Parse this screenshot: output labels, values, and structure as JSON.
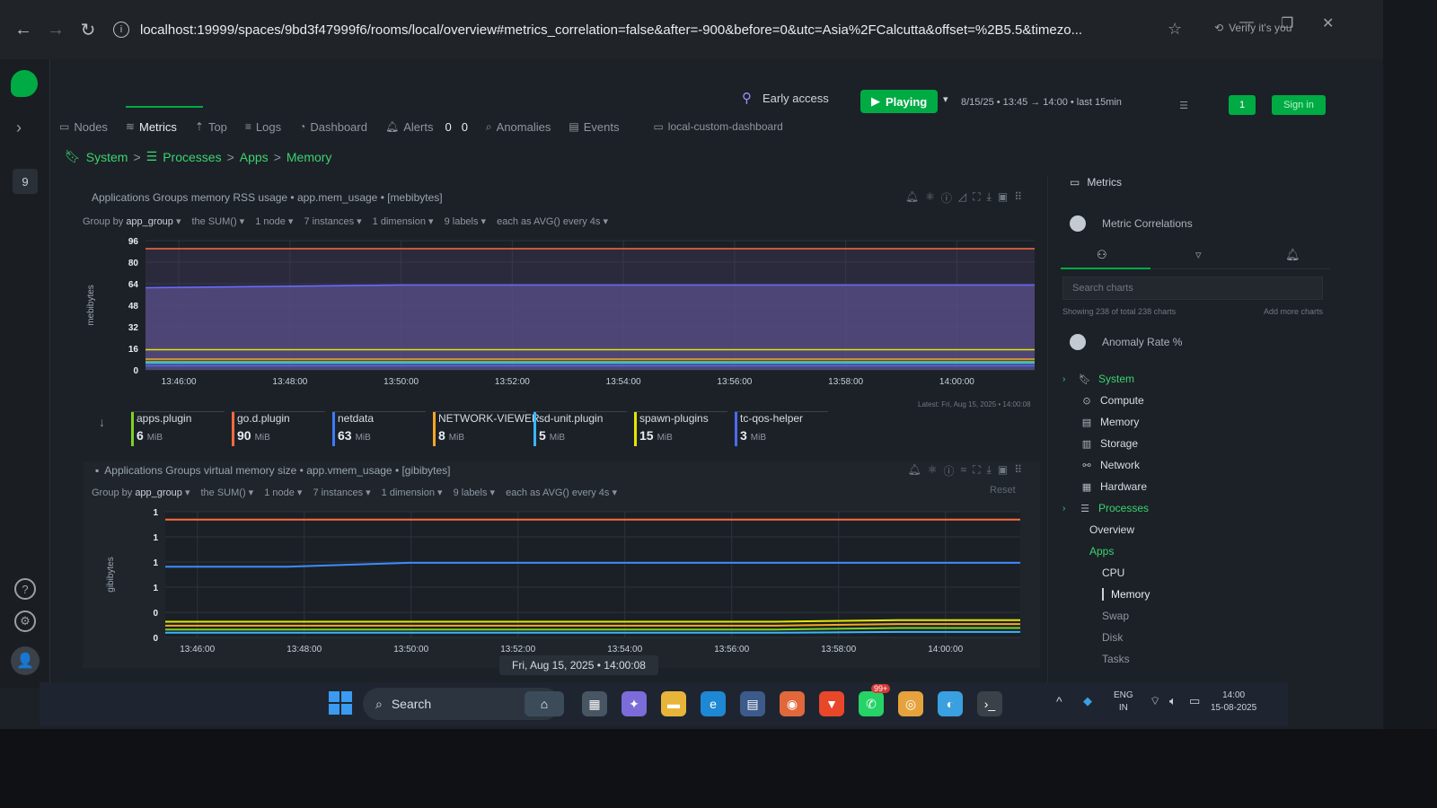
{
  "browser": {
    "url_host": "localhost:19999",
    "url_path": "/spaces/9bd3f47999f6/rooms/local/overview#metrics_correlation=false&after=-900&before=0&utc=Asia%2FCalcutta&offset=%2B5.5&timezo...",
    "verify_label": "Verify it's you"
  },
  "rail": {
    "badge": "9"
  },
  "header": {
    "early_access": "Early access",
    "playing": "Playing",
    "date_range": "8/15/25 • 13:45 → 14:00 • last 15min",
    "alerts_counts": [
      "0",
      "0"
    ],
    "sign_in": "Sign in",
    "counter": "1"
  },
  "tabs": [
    {
      "label": "Nodes",
      "icon": "nodes-icon"
    },
    {
      "label": "Metrics",
      "icon": "metrics-icon"
    },
    {
      "label": "Top",
      "icon": "top-icon"
    },
    {
      "label": "Logs",
      "icon": "logs-icon"
    },
    {
      "label": "Dashboard",
      "icon": "dashboard-icon"
    },
    {
      "label": "Alerts",
      "icon": "alerts-icon"
    },
    {
      "label": "Anomalies",
      "icon": "anomalies-icon"
    },
    {
      "label": "Events",
      "icon": "events-icon"
    },
    {
      "label": "local-custom-dashboard",
      "icon": "custom-dashboard-icon"
    }
  ],
  "breadcrumb": [
    "System",
    "Processes",
    "Apps",
    "Memory"
  ],
  "chart1": {
    "title": "Applications Groups memory RSS usage • app.mem_usage • [mebibytes]",
    "group_by_label": "Group by",
    "group_by": "app_group",
    "the_sum": "the SUM()",
    "nodes": "1 node",
    "instances": "7 instances",
    "dimensions": "1 dimension",
    "labels": "9 labels",
    "each_as": "each as AVG() every 4s",
    "ylabel": "mebibytes",
    "latest": "Latest: Fri, Aug 15, 2025 • 14:00:08",
    "legend": [
      {
        "name": "apps.plugin",
        "value": "6",
        "unit": "MiB",
        "color": "#7ed321"
      },
      {
        "name": "go.d.plugin",
        "value": "90",
        "unit": "MiB",
        "color": "#ff6b3d"
      },
      {
        "name": "netdata",
        "value": "63",
        "unit": "MiB",
        "color": "#3d7bff"
      },
      {
        "name": "NETWORK-VIEWER",
        "value": "8",
        "unit": "MiB",
        "color": "#f5a623"
      },
      {
        "name": "sd-unit.plugin",
        "value": "5",
        "unit": "MiB",
        "color": "#38b6ff"
      },
      {
        "name": "spawn-plugins",
        "value": "15",
        "unit": "MiB",
        "color": "#e6e600"
      },
      {
        "name": "tc-qos-helper",
        "value": "3",
        "unit": "MiB",
        "color": "#4a6cf7"
      }
    ]
  },
  "chart2": {
    "title": "Applications Groups virtual memory size • app.vmem_usage • [gibibytes]",
    "group_by_label": "Group by",
    "group_by": "app_group",
    "the_sum": "the SUM()",
    "nodes": "1 node",
    "instances": "7 instances",
    "dimensions": "1 dimension",
    "labels": "9 labels",
    "each_as": "each as AVG() every 4s",
    "ylabel": "gibibytes",
    "reset": "Reset"
  },
  "timestamp_pill": "Fri, Aug 15, 2025 • 14:00:08",
  "chart_data": [
    {
      "type": "area",
      "title": "Applications Groups memory RSS usage • app.mem_usage • [mebibytes]",
      "ylabel": "mebibytes",
      "ylim": [
        0,
        96
      ],
      "yticks": [
        "0",
        "16",
        "32",
        "48",
        "64",
        "80",
        "96"
      ],
      "xticks": [
        "13:46:00",
        "13:48:00",
        "13:50:00",
        "13:52:00",
        "13:54:00",
        "13:56:00",
        "13:58:00",
        "14:00:00"
      ],
      "series": [
        {
          "name": "go.d.plugin",
          "values": [
            90,
            90,
            90,
            90,
            90,
            90,
            90,
            90
          ],
          "color": "#ff6b3d"
        },
        {
          "name": "netdata",
          "values": [
            61,
            62,
            63,
            63,
            63,
            63,
            63,
            63
          ],
          "color": "#6a6cff"
        },
        {
          "name": "spawn-plugins",
          "values": [
            15,
            15,
            15,
            15,
            15,
            15,
            15,
            15
          ],
          "color": "#e6e600"
        },
        {
          "name": "NETWORK-VIEWER",
          "values": [
            8,
            8,
            8,
            8,
            8,
            8,
            8,
            8
          ],
          "color": "#f5a623"
        },
        {
          "name": "apps.plugin",
          "values": [
            6,
            6,
            6,
            6,
            6,
            6,
            6,
            6
          ],
          "color": "#7ed321"
        },
        {
          "name": "sd-unit.plugin",
          "values": [
            5,
            5,
            5,
            5,
            5,
            5,
            5,
            5
          ],
          "color": "#38b6ff"
        },
        {
          "name": "tc-qos-helper",
          "values": [
            3,
            3,
            3,
            3,
            3,
            3,
            3,
            3
          ],
          "color": "#4a6cf7"
        }
      ]
    },
    {
      "type": "line",
      "title": "Applications Groups virtual memory size • app.vmem_usage • [gibibytes]",
      "ylabel": "gibibytes",
      "ylim": [
        0,
        1.6
      ],
      "yticks": [
        "0",
        "0",
        "1",
        "1",
        "1",
        "1"
      ],
      "xticks": [
        "13:46:00",
        "13:48:00",
        "13:50:00",
        "13:52:00",
        "13:54:00",
        "13:56:00",
        "13:58:00",
        "14:00:00"
      ],
      "series": [
        {
          "name": "go.d.plugin",
          "values": [
            1.5,
            1.5,
            1.5,
            1.5,
            1.5,
            1.5,
            1.5,
            1.5
          ],
          "color": "#ff6b3d"
        },
        {
          "name": "netdata",
          "values": [
            0.9,
            0.9,
            0.95,
            0.95,
            0.95,
            0.95,
            0.95,
            0.95
          ],
          "color": "#3d8bff"
        },
        {
          "name": "spawn-plugins",
          "values": [
            0.2,
            0.2,
            0.2,
            0.2,
            0.2,
            0.2,
            0.22,
            0.22
          ],
          "color": "#e6e600"
        },
        {
          "name": "NETWORK-VIEWER",
          "values": [
            0.15,
            0.15,
            0.15,
            0.15,
            0.15,
            0.15,
            0.17,
            0.17
          ],
          "color": "#f5a623"
        },
        {
          "name": "apps.plugin",
          "values": [
            0.1,
            0.1,
            0.1,
            0.1,
            0.1,
            0.1,
            0.12,
            0.12
          ],
          "color": "#7ed321"
        },
        {
          "name": "sd-unit.plugin",
          "values": [
            0.06,
            0.06,
            0.06,
            0.06,
            0.06,
            0.06,
            0.07,
            0.07
          ],
          "color": "#38b6ff"
        }
      ]
    }
  ],
  "right_panel": {
    "metrics_label": "Metrics",
    "metric_correlations": "Metric Correlations",
    "search_placeholder": "Search charts",
    "showing": "Showing 238 of total 238 charts",
    "add_more": "Add more charts",
    "anomaly_rate": "Anomaly Rate %",
    "tree": [
      {
        "label": "System",
        "icon": "bookmark-icon",
        "style": "green",
        "chev": true
      },
      {
        "label": "Compute",
        "icon": "compute-icon",
        "style": "normal",
        "indent": 1
      },
      {
        "label": "Memory",
        "icon": "memory-icon",
        "style": "normal",
        "indent": 1
      },
      {
        "label": "Storage",
        "icon": "storage-icon",
        "style": "normal",
        "indent": 1
      },
      {
        "label": "Network",
        "icon": "network-icon",
        "style": "normal",
        "indent": 1
      },
      {
        "label": "Hardware",
        "icon": "hardware-icon",
        "style": "normal",
        "indent": 1
      },
      {
        "label": "Processes",
        "icon": "processes-icon",
        "style": "green",
        "indent": 0,
        "chev": true
      },
      {
        "label": "Overview",
        "style": "normal",
        "indent": 2
      },
      {
        "label": "Apps",
        "style": "green",
        "indent": 2
      },
      {
        "label": "CPU",
        "style": "normal",
        "indent": 3
      },
      {
        "label": "Memory",
        "style": "active",
        "indent": 3
      },
      {
        "label": "Swap",
        "style": "muted",
        "indent": 3
      },
      {
        "label": "Disk",
        "style": "muted",
        "indent": 3
      },
      {
        "label": "Tasks",
        "style": "muted",
        "indent": 3
      }
    ]
  },
  "taskbar": {
    "search": "Search",
    "lang_top": "ENG",
    "lang_bottom": "IN",
    "time": "14:00",
    "date": "15-08-2025",
    "badge": "99+"
  }
}
